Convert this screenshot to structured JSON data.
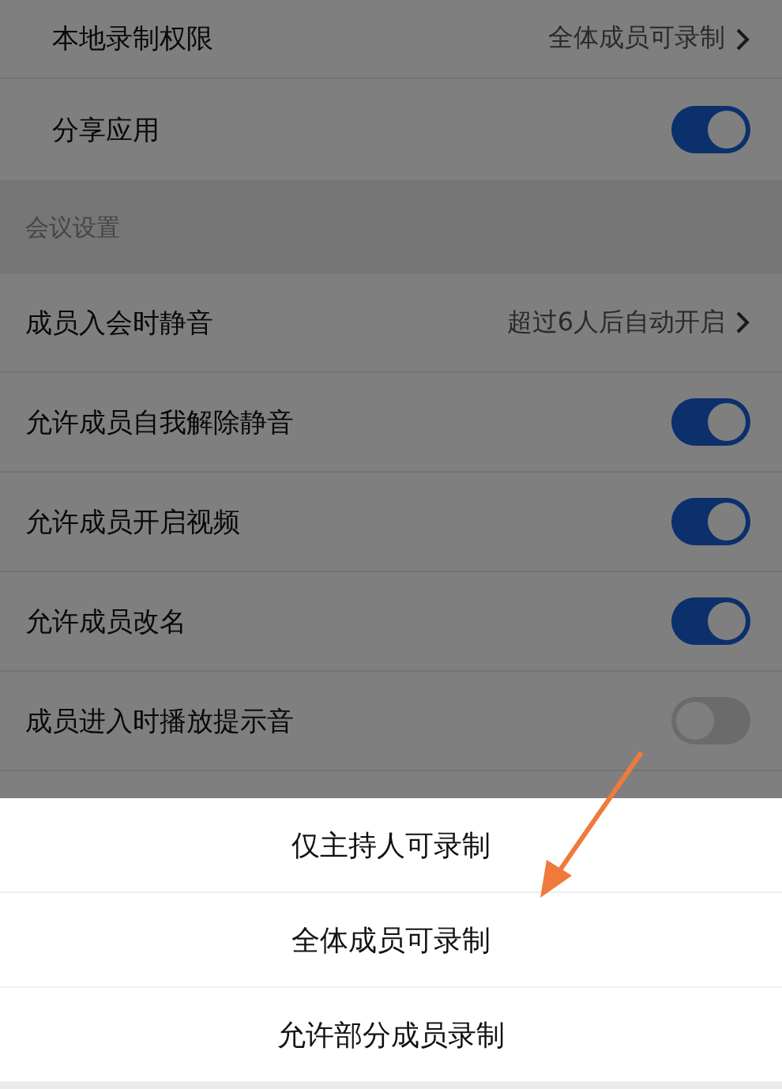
{
  "sections": [
    {
      "rows": [
        {
          "kind": "link",
          "label": "本地录制权限",
          "value": "全体成员可录制"
        },
        {
          "kind": "toggle",
          "label": "分享应用",
          "on": true
        }
      ]
    },
    {
      "title": "会议设置",
      "rows": [
        {
          "kind": "link",
          "label": "成员入会时静音",
          "value": "超过6人后自动开启"
        },
        {
          "kind": "toggle",
          "label": "允许成员自我解除静音",
          "on": true
        },
        {
          "kind": "toggle",
          "label": "允许成员开启视频",
          "on": true
        },
        {
          "kind": "toggle",
          "label": "允许成员改名",
          "on": true
        },
        {
          "kind": "toggle",
          "label": "成员进入时播放提示音",
          "on": false
        }
      ]
    }
  ],
  "sheet": {
    "options": [
      "仅主持人可录制",
      "全体成员可录制",
      "允许部分成员录制"
    ]
  }
}
